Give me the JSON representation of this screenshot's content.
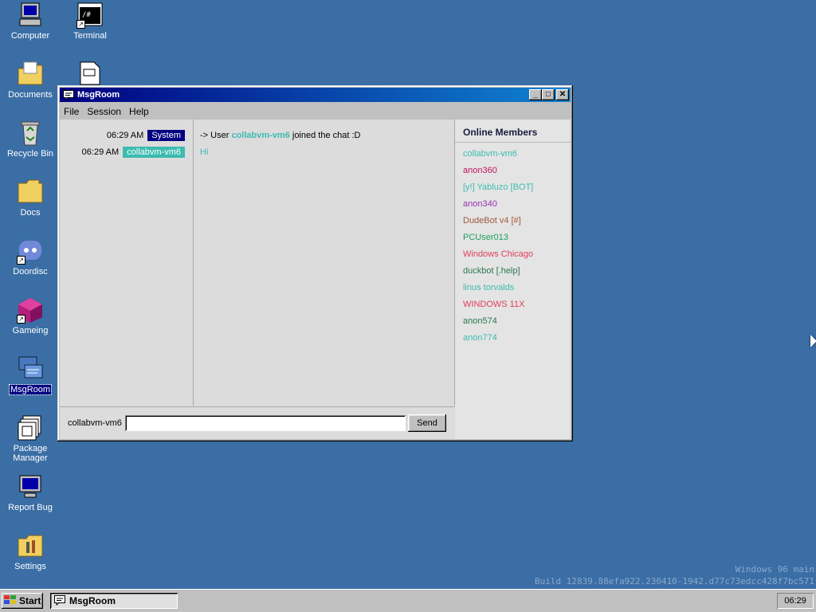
{
  "desktop": {
    "icons": [
      {
        "label": "Computer",
        "icon": "computer-icon"
      },
      {
        "label": "Terminal",
        "icon": "terminal-icon"
      },
      {
        "label": "Documents",
        "icon": "folder-icon"
      },
      {
        "label": "Recycle Bin",
        "icon": "recycle-bin-icon"
      },
      {
        "label": "Docs",
        "icon": "folder-icon"
      },
      {
        "label": "Doordisc",
        "icon": "doordisc-icon"
      },
      {
        "label": "Gameing",
        "icon": "cube-icon"
      },
      {
        "label": "MsgRoom",
        "icon": "msgroom-icon"
      },
      {
        "label": "Package Manager",
        "icon": "package-manager-icon"
      },
      {
        "label": "Report Bug",
        "icon": "report-bug-icon"
      },
      {
        "label": "Settings",
        "icon": "settings-icon"
      }
    ],
    "watermark": {
      "line1": "Windows 96 main",
      "line2": "Build 12839.88efa922.230410-1942.d77c73edcc428f7bc571"
    }
  },
  "window": {
    "title": "MsgRoom",
    "controls": {
      "minimize": "_",
      "maximize": "□",
      "close": "✕"
    },
    "menu": [
      "File",
      "Session",
      "Help"
    ],
    "messages": [
      {
        "time": "06:29 AM",
        "sender": "System",
        "sender_color": "#000080",
        "prefix": "-> User ",
        "user": "collabvm-vm6",
        "suffix": " joined the chat :D"
      },
      {
        "time": "06:29 AM",
        "sender": "collabvm-vm6",
        "sender_color": "#3cbcb0",
        "text": "Hi",
        "text_color": "#3cbcb0"
      }
    ],
    "members_title": "Online Members",
    "members": [
      {
        "name": "collabvm-vm6",
        "color": "#3cbcb0"
      },
      {
        "name": "anon360",
        "color": "#c0145a"
      },
      {
        "name": "[y!] Yabluzo [BOT]",
        "color": "#3cbcb0"
      },
      {
        "name": "anon340",
        "color": "#9a30b0"
      },
      {
        "name": "DudeBot v4 [#]",
        "color": "#a05a3c"
      },
      {
        "name": "PCUser013",
        "color": "#20a060"
      },
      {
        "name": "Windows Chicago",
        "color": "#e03c5a"
      },
      {
        "name": "duckbot [.help]",
        "color": "#287850"
      },
      {
        "name": "linus torvalds",
        "color": "#3cbcb0"
      },
      {
        "name": "WINDOWS 11X",
        "color": "#e03c5a"
      },
      {
        "name": "anon574",
        "color": "#287850"
      },
      {
        "name": "anon774",
        "color": "#3cbcb0"
      }
    ],
    "input": {
      "nick": "collabvm-vm6",
      "value": "",
      "send_label": "Send"
    }
  },
  "taskbar": {
    "start_label": "Start",
    "task_label": "MsgRoom",
    "clock": "06:29"
  }
}
